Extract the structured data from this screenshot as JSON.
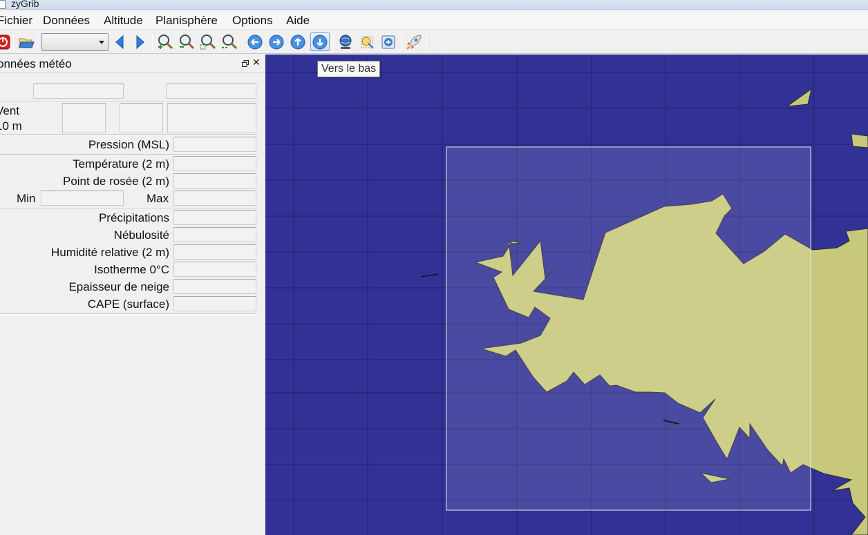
{
  "window": {
    "title": "zyGrib"
  },
  "menu": {
    "items": [
      {
        "key": "fichier",
        "label": "Fichier"
      },
      {
        "key": "donnees",
        "label": "Données"
      },
      {
        "key": "altitude",
        "label": "Altitude"
      },
      {
        "key": "planisphere",
        "label": "Planisphère"
      },
      {
        "key": "options",
        "label": "Options"
      },
      {
        "key": "aide",
        "label": "Aide"
      }
    ]
  },
  "toolbar": {
    "date_combo_value": "",
    "tooltip": "Vers le bas",
    "icons": [
      "quit-icon",
      "open-file-icon",
      "date-select",
      "previous-date-icon",
      "next-date-icon",
      "zoom-in-icon",
      "zoom-out-icon",
      "zoom-selection-icon",
      "zoom-all-icon",
      "move-left-icon",
      "move-right-icon",
      "move-up-icon",
      "move-down-icon",
      "download-grib-icon",
      "download-zone-icon",
      "server-status-icon",
      "rocket-icon"
    ]
  },
  "panel": {
    "title": "onnées météo",
    "wind_label_line1": "Vent",
    "wind_label_line2": "10 m",
    "rows": [
      {
        "key": "pressure",
        "label": "Pression (MSL)",
        "value": ""
      },
      {
        "key": "temperature",
        "label": "Température (2 m)",
        "value": ""
      },
      {
        "key": "dewpoint",
        "label": "Point de rosée (2 m)",
        "value": ""
      },
      {
        "key": "precip",
        "label": "Précipitations",
        "value": ""
      },
      {
        "key": "cloud",
        "label": "Nébulosité",
        "value": ""
      },
      {
        "key": "humidity",
        "label": "Humidité relative (2 m)",
        "value": ""
      },
      {
        "key": "isotherm",
        "label": "Isotherme 0°C",
        "value": ""
      },
      {
        "key": "snow",
        "label": "Epaisseur de neige",
        "value": ""
      },
      {
        "key": "cape",
        "label": "CAPE (surface)",
        "value": ""
      }
    ],
    "min_label": "Min",
    "max_label": "Max"
  },
  "map": {
    "sea_color": "#323296",
    "land_color": "#c8c87c",
    "grid_color": "#26266e",
    "selection_border": "#e8e8e8"
  }
}
